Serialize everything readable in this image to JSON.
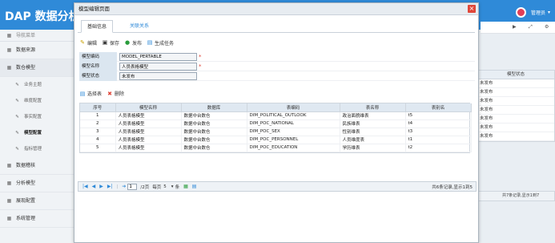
{
  "header": {
    "app_title": "DAP 数据分析平",
    "user_name": "管理员",
    "user_caret": "▾"
  },
  "sidebar": {
    "nav_header": "导航菜单",
    "items": [
      {
        "label": "数据来源",
        "icon": "▦"
      },
      {
        "label": "数仓模型",
        "icon": "▦"
      },
      {
        "label": "数据稽核",
        "icon": "▦"
      },
      {
        "label": "分析模型",
        "icon": "▦"
      },
      {
        "label": "展现配置",
        "icon": "▦"
      },
      {
        "label": "系统管理",
        "icon": "▦"
      }
    ],
    "sub_items": [
      {
        "label": "业务主题",
        "icon": "✎"
      },
      {
        "label": "维度配置",
        "icon": "✎"
      },
      {
        "label": "事实配置",
        "icon": "✎"
      },
      {
        "label": "模型配置",
        "icon": "✎"
      },
      {
        "label": "指标管理",
        "icon": "✎"
      }
    ]
  },
  "background": {
    "tool_icons": [
      "▶",
      "⤢",
      "⚙"
    ],
    "table_header": "模型状态",
    "rows": [
      "未发布",
      "未发布",
      "未发布",
      "未发布",
      "未发布",
      "未发布",
      "未发布"
    ],
    "footer": "共7条记录,显示1到7"
  },
  "modal": {
    "title": "模型编辑页面",
    "close_icon": "×",
    "tabs": {
      "basic": "基础信息",
      "relation": "关联关系"
    },
    "toolbar": {
      "edit": "编辑",
      "save": "保存",
      "publish": "发布",
      "generate": "生成任务"
    },
    "form": {
      "code_label": "模型编码",
      "code_value": "MODEL_PERTABLE",
      "name_label": "模型名称",
      "name_value": "人员表格模型",
      "status_label": "模型状态",
      "status_value": "未发布",
      "required_mark": "*"
    },
    "subtoolbar": {
      "select_table": "选择表",
      "delete": "删除"
    },
    "grid": {
      "columns": [
        "序号",
        "模型名称",
        "数据库",
        "表编码",
        "表名称",
        "表别名"
      ],
      "rows": [
        [
          "1",
          "人员表格模型",
          "数据中台数仓",
          "DIM_POLITICAL_OUTLOOK",
          "政治面貌维表",
          "t5"
        ],
        [
          "2",
          "人员表格模型",
          "数据中台数仓",
          "DIM_POC_NATIONAL",
          "民族维表",
          "t4"
        ],
        [
          "3",
          "人员表格模型",
          "数据中台数仓",
          "DIM_POC_SEX",
          "性别维表",
          "t3"
        ],
        [
          "4",
          "人员表格模型",
          "数据中台数仓",
          "DIM_POC_PERSONNEL",
          "人员维度表",
          "t1"
        ],
        [
          "5",
          "人员表格模型",
          "数据中台数仓",
          "DIM_POC_EDUCATION",
          "学历维表",
          "t2"
        ]
      ]
    },
    "pager": {
      "first": "|◀",
      "prev": "◀",
      "next": "▶",
      "last": "▶|",
      "page_value": "1",
      "page_total": "/2页",
      "per_page_label": "每页",
      "per_page_value": "5",
      "per_page_caret": "▾",
      "per_page_suffix": "条",
      "summary": "共6条记录,显示1到5"
    }
  }
}
